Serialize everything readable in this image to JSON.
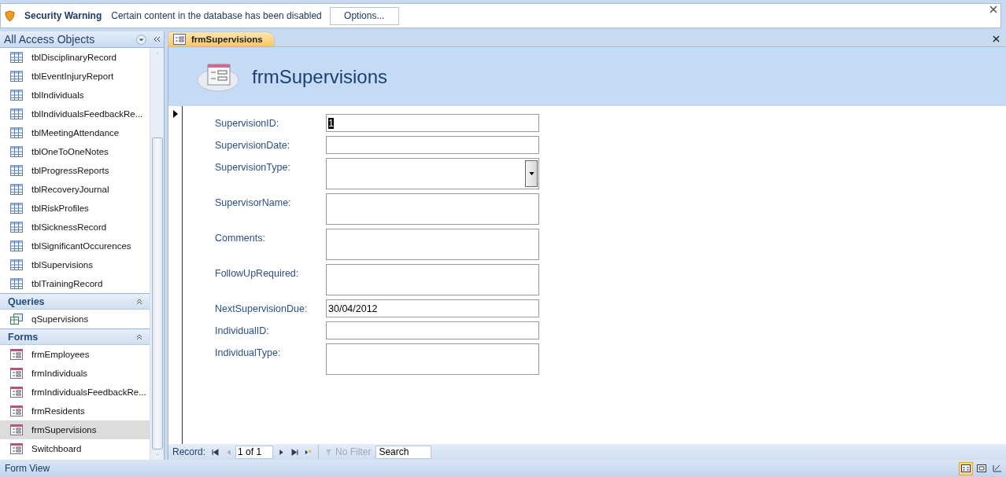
{
  "security_bar": {
    "title": "Security Warning",
    "message": "Certain content in the database has been disabled",
    "button": "Options..."
  },
  "nav_pane": {
    "title": "All Access Objects",
    "groups": [
      {
        "items": [
          {
            "label": "tblDisciplinaryRecord",
            "kind": "table",
            "selected": false
          },
          {
            "label": "tblEventInjuryReport",
            "kind": "table",
            "selected": false
          },
          {
            "label": "tblIndividuals",
            "kind": "table",
            "selected": false
          },
          {
            "label": "tblIndividualsFeedbackRe...",
            "kind": "table",
            "selected": false
          },
          {
            "label": "tblMeetingAttendance",
            "kind": "table",
            "selected": false
          },
          {
            "label": "tblOneToOneNotes",
            "kind": "table",
            "selected": false
          },
          {
            "label": "tblProgressReports",
            "kind": "table",
            "selected": false
          },
          {
            "label": "tblRecoveryJournal",
            "kind": "table",
            "selected": false
          },
          {
            "label": "tblRiskProfiles",
            "kind": "table",
            "selected": false
          },
          {
            "label": "tblSicknessRecord",
            "kind": "table",
            "selected": false
          },
          {
            "label": "tblSignificantOccurences",
            "kind": "table",
            "selected": false
          },
          {
            "label": "tblSupervisions",
            "kind": "table",
            "selected": false
          },
          {
            "label": "tblTrainingRecord",
            "kind": "table",
            "selected": false
          }
        ]
      },
      {
        "header": "Queries",
        "items": [
          {
            "label": "qSupervisions",
            "kind": "query",
            "selected": false
          }
        ]
      },
      {
        "header": "Forms",
        "items": [
          {
            "label": "frmEmployees",
            "kind": "form",
            "selected": false
          },
          {
            "label": "frmIndividuals",
            "kind": "form",
            "selected": false
          },
          {
            "label": "frmIndividualsFeedbackRe...",
            "kind": "form",
            "selected": false
          },
          {
            "label": "frmResidents",
            "kind": "form",
            "selected": false
          },
          {
            "label": "frmSupervisions",
            "kind": "form",
            "selected": true
          },
          {
            "label": "Switchboard",
            "kind": "form",
            "selected": false
          }
        ]
      }
    ]
  },
  "document_tab": {
    "label": "frmSupervisions",
    "selected": true
  },
  "form": {
    "title": "frmSupervisions",
    "fields": [
      {
        "label": "SupervisionID:",
        "kind": "text",
        "value": "1",
        "value_selected": true
      },
      {
        "label": "SupervisionDate:",
        "kind": "text"
      },
      {
        "label": "SupervisionType:",
        "kind": "combo"
      },
      {
        "label": "SupervisorName:",
        "kind": "memo"
      },
      {
        "label": "Comments:",
        "kind": "memo"
      },
      {
        "label": "FollowUpRequired:",
        "kind": "memo"
      },
      {
        "label": "NextSupervisionDue:",
        "kind": "text",
        "value": "30/04/2012",
        "value_selected": false
      },
      {
        "label": "IndividualID:",
        "kind": "text"
      },
      {
        "label": "IndividualType:",
        "kind": "memo"
      }
    ]
  },
  "record_nav": {
    "label": "Record:",
    "position": "1 of 1",
    "filter": "No Filter",
    "search": "Search"
  },
  "status_bar": {
    "text": "Form View"
  }
}
